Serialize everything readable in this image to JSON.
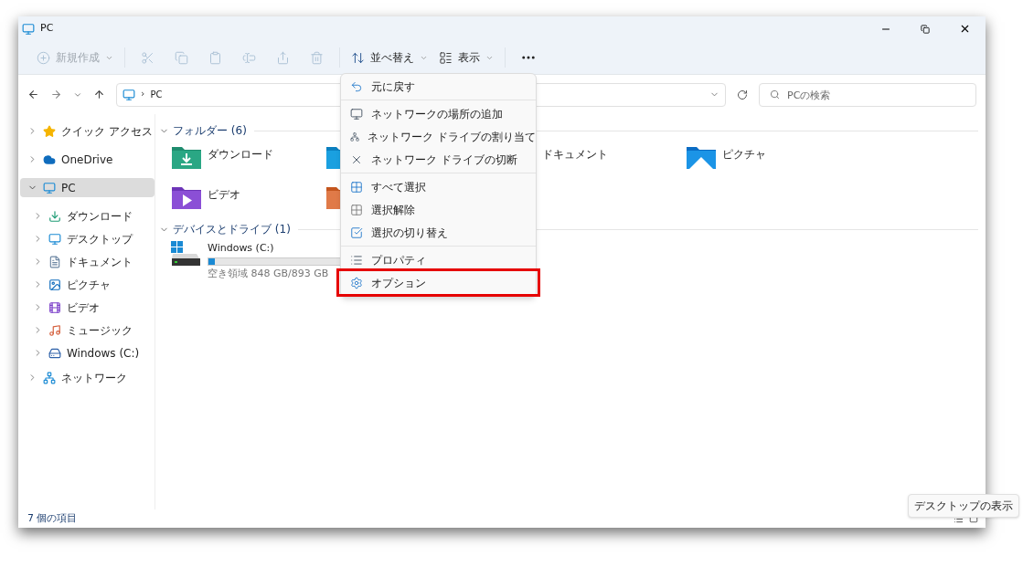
{
  "window": {
    "title": "PC"
  },
  "toolbar": [
    {
      "kind": "new",
      "label": "新規作成",
      "disabled": true
    },
    {
      "kind": "cut",
      "disabled": true
    },
    {
      "kind": "copy",
      "disabled": true
    },
    {
      "kind": "paste",
      "disabled": true
    },
    {
      "kind": "rename",
      "disabled": true
    },
    {
      "kind": "share",
      "disabled": true
    },
    {
      "kind": "delete",
      "disabled": true
    },
    {
      "kind": "sort",
      "label": "並べ替え",
      "disabled": false
    },
    {
      "kind": "view",
      "label": "表示",
      "disabled": false
    },
    {
      "kind": "more",
      "disabled": false
    }
  ],
  "address": {
    "path": "PC",
    "separator": "›"
  },
  "search": {
    "placeholder": "PCの検索"
  },
  "sidebar": [
    {
      "label": "クイック アクセス",
      "kind": "star",
      "expanded": false,
      "selected": false
    },
    {
      "label": "OneDrive",
      "kind": "cloud",
      "expanded": false,
      "selected": false
    },
    {
      "label": "PC",
      "kind": "pc",
      "expanded": true,
      "selected": true,
      "children": [
        {
          "label": "ダウンロード",
          "kind": "download",
          "expanded": false,
          "selected": false
        },
        {
          "label": "デスクトップ",
          "kind": "desktop",
          "expanded": false,
          "selected": false
        },
        {
          "label": "ドキュメント",
          "kind": "documents",
          "expanded": false,
          "selected": false
        },
        {
          "label": "ピクチャ",
          "kind": "pictures",
          "expanded": false,
          "selected": false
        },
        {
          "label": "ビデオ",
          "kind": "videos",
          "expanded": false,
          "selected": false
        },
        {
          "label": "ミュージック",
          "kind": "music",
          "expanded": false,
          "selected": false
        },
        {
          "label": "Windows (C:)",
          "kind": "drive",
          "expanded": false,
          "selected": false
        }
      ]
    },
    {
      "label": "ネットワーク",
      "kind": "network",
      "expanded": false,
      "selected": false
    }
  ],
  "folders_section": {
    "title": "フォルダー (6)",
    "expanded": true,
    "items": [
      {
        "kind": "download",
        "label": "ダウンロード"
      },
      {
        "kind": "desktop"
      },
      {
        "kind": "documents",
        "label": "ドキュメント"
      },
      {
        "kind": "pictures",
        "label": "ピクチャ"
      },
      {
        "kind": "videos",
        "label": "ビデオ"
      },
      {
        "kind": "music"
      }
    ]
  },
  "drives_section": {
    "title": "デバイスとドライブ (1)",
    "expanded": true,
    "items": [
      {
        "name": "Windows (C:)",
        "level": 0.05,
        "free": "空き領域 848 GB/893 GB"
      }
    ]
  },
  "context_menu": [
    [
      {
        "kind": "undo",
        "label": "元に戻す",
        "highlighted": false
      }
    ],
    [
      {
        "kind": "net-add",
        "label": "ネットワークの場所の追加",
        "highlighted": false
      },
      {
        "kind": "net-map",
        "label": "ネットワーク ドライブの割り当て",
        "highlighted": false
      },
      {
        "kind": "net-disconnect",
        "label": "ネットワーク ドライブの切断",
        "highlighted": false
      }
    ],
    [
      {
        "kind": "select-all",
        "label": "すべて選択",
        "highlighted": false
      },
      {
        "kind": "select-none",
        "label": "選択解除",
        "highlighted": false
      },
      {
        "kind": "select-invert",
        "label": "選択の切り替え",
        "highlighted": false
      }
    ],
    [
      {
        "kind": "properties",
        "label": "プロパティ",
        "highlighted": false
      },
      {
        "kind": "options",
        "label": "オプション",
        "highlighted": true
      }
    ]
  ],
  "status_bar": {
    "count": "7 個の項目"
  },
  "tooltip": "デスクトップの表示"
}
